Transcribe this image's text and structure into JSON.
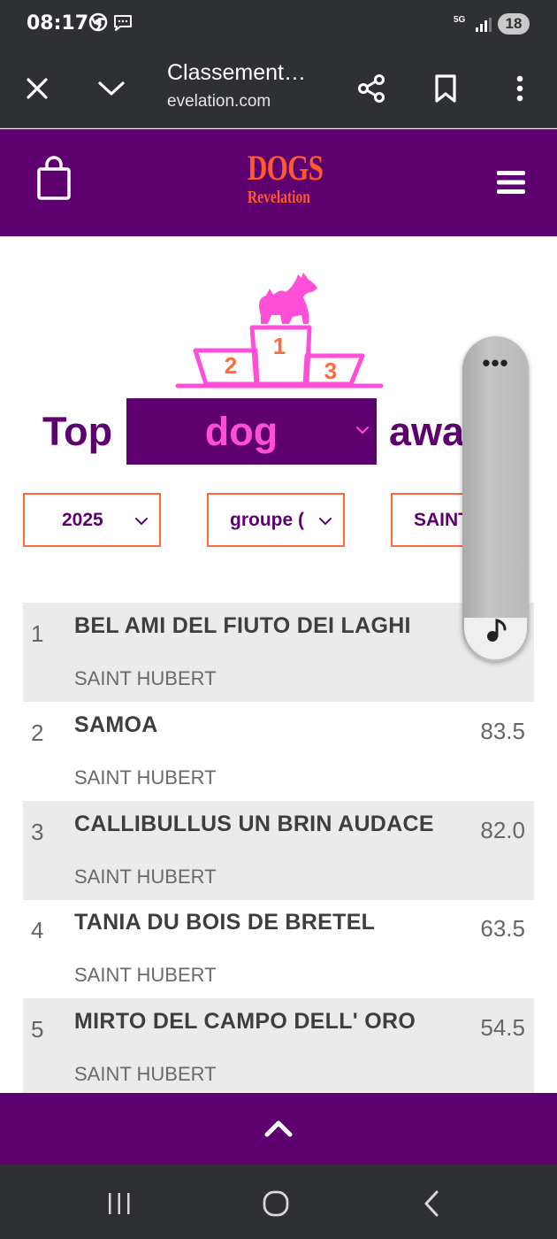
{
  "status_bar": {
    "time": "08:17",
    "network": "5G",
    "battery": "18"
  },
  "browser": {
    "title": "Classement…",
    "url": "evelation.com"
  },
  "site": {
    "logo_line1": "DOGS",
    "logo_line2": "Revelation"
  },
  "award": {
    "prefix": "Top",
    "selected_category": "dog",
    "suffix": "awa",
    "podium_places": [
      "1",
      "2",
      "3"
    ]
  },
  "filters": {
    "year": "2025",
    "group": "groupe (",
    "breed": "SAINT"
  },
  "ranking": [
    {
      "rank": "1",
      "name": "BEL AMI DEL FIUTO DEI LAGHI",
      "breed": "SAINT HUBERT",
      "score": ""
    },
    {
      "rank": "2",
      "name": "SAMOA",
      "breed": "SAINT HUBERT",
      "score": "83.5"
    },
    {
      "rank": "3",
      "name": "CALLIBULLUS UN BRIN AUDACE",
      "breed": "SAINT HUBERT",
      "score": "82.0"
    },
    {
      "rank": "4",
      "name": "TANIA DU BOIS DE BRETEL",
      "breed": "SAINT HUBERT",
      "score": "63.5"
    },
    {
      "rank": "5",
      "name": "MIRTO DEL CAMPO DELL' ORO",
      "breed": "SAINT HUBERT",
      "score": "54.5"
    }
  ],
  "floating_panel": {
    "menu_glyph": "•••"
  },
  "colors": {
    "brand_purple": "#5e0070",
    "accent_pink": "#ff4fd8",
    "accent_orange": "#ff6a3d",
    "row_shade": "#ebebeb"
  },
  "icons": [
    "chrome-icon",
    "message-icon",
    "signal-icon",
    "close-icon",
    "chevron-down-icon",
    "share-icon",
    "bookmark-icon",
    "more-vert-icon",
    "shopping-bag-icon",
    "hamburger-menu-icon",
    "podium-dog-icon",
    "music-note-icon",
    "chevron-up-icon",
    "recent-apps-icon",
    "home-icon",
    "back-icon"
  ]
}
